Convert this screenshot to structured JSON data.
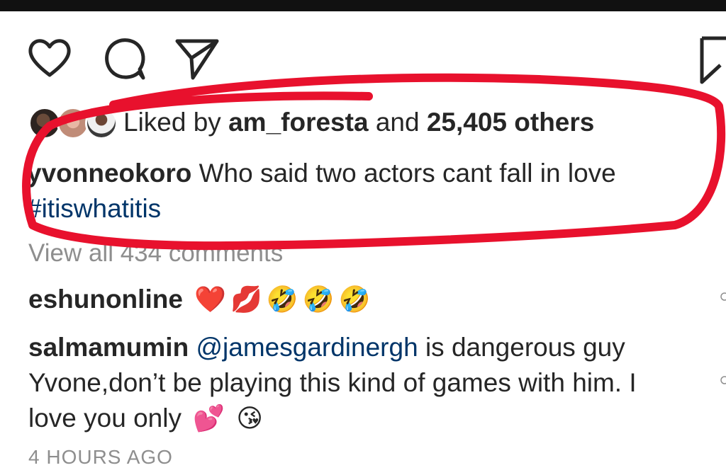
{
  "post": {
    "likes": {
      "prefix": "Liked by",
      "user": "am_foresta",
      "middle": "and",
      "count": "25,405 others"
    },
    "caption": {
      "username": "yvonneokoro",
      "text": "Who said two actors cant fall in love",
      "hashtag": "#itiswhatitis"
    },
    "view_all": "View all 434 comments",
    "comments": [
      {
        "username": "eshunonline",
        "emojis": [
          "❤️",
          "💋",
          "🤣",
          "🤣",
          "🤣"
        ]
      },
      {
        "username": "salmamumin",
        "mention": "@jamesgardinergh",
        "text": "is dangerous guy Yvone,don’t be playing this kind of games with him. I love you only",
        "emojis": [
          "💕",
          "😘"
        ]
      }
    ],
    "timestamp": "4 HOURS AGO"
  },
  "icons": {
    "like": "heart-icon",
    "comment": "comment-icon",
    "share": "share-icon",
    "save": "bookmark-icon"
  },
  "colors": {
    "text": "#262626",
    "link": "#003569",
    "secondary": "#8e8e8e",
    "annotation": "#e8112d"
  }
}
